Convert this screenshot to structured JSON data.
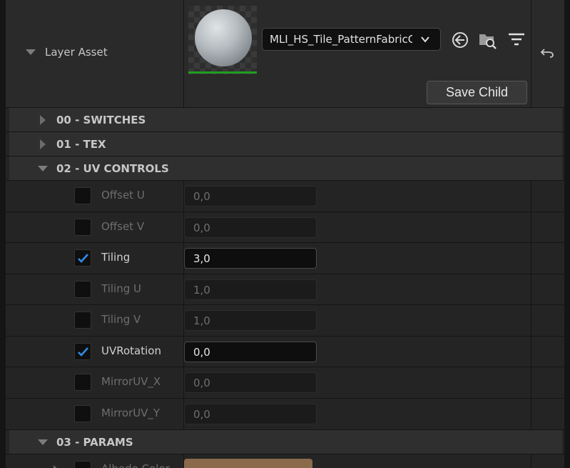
{
  "layer_asset": {
    "label": "Layer Asset",
    "asset_name": "MLI_HS_Tile_PatternFabricC",
    "save_child_label": "Save Child"
  },
  "categories": [
    {
      "label": "00 - SWITCHES",
      "expanded": false
    },
    {
      "label": "01 - TEX",
      "expanded": false
    },
    {
      "label": "02 - UV CONTROLS",
      "expanded": true
    },
    {
      "label": "03 - PARAMS",
      "expanded": true
    }
  ],
  "uv_params": [
    {
      "label": "Offset U",
      "value": "0,0",
      "enabled": false
    },
    {
      "label": "Offset V",
      "value": "0,0",
      "enabled": false
    },
    {
      "label": "Tiling",
      "value": "3,0",
      "enabled": true
    },
    {
      "label": "Tiling U",
      "value": "1,0",
      "enabled": false
    },
    {
      "label": "Tiling V",
      "value": "1,0",
      "enabled": false
    },
    {
      "label": "UVRotation",
      "value": "0,0",
      "enabled": true
    },
    {
      "label": "MirrorUV_X",
      "value": "0,0",
      "enabled": false
    },
    {
      "label": "MirrorUV_Y",
      "value": "0,0",
      "enabled": false
    }
  ],
  "params_partial": {
    "label": "Albedo Color",
    "color": "#8a6a4b"
  },
  "icons": [
    "back-arrow-icon",
    "browse-folder-icon",
    "filter-icon",
    "reset-arrow-icon",
    "chevron-down-icon",
    "checkmark-icon"
  ],
  "colors": {
    "accent_check": "#2f8ce6",
    "thumbnail_bar": "#1f9e1f"
  }
}
